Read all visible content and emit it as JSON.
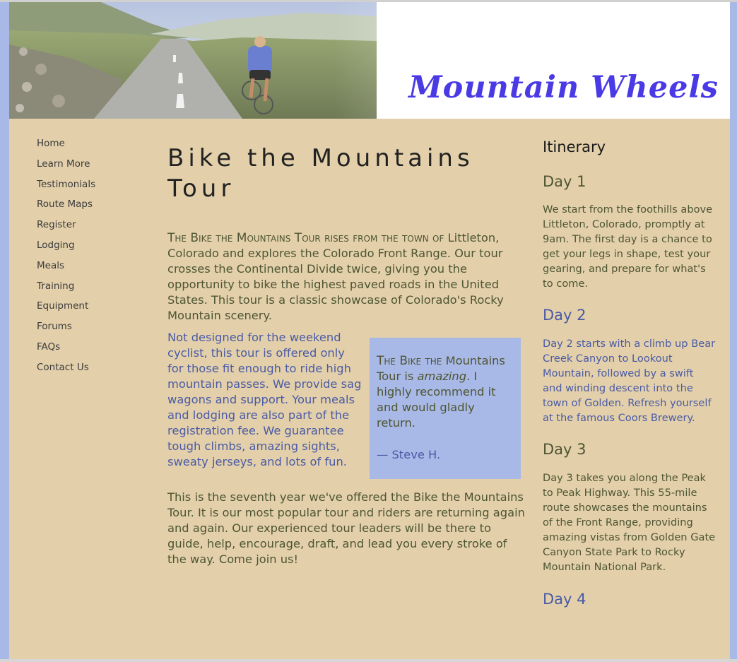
{
  "site": {
    "title": "Mountain Wheels"
  },
  "nav": {
    "items": [
      {
        "label": "Home"
      },
      {
        "label": "Learn More"
      },
      {
        "label": "Testimonials"
      },
      {
        "label": "Route Maps"
      },
      {
        "label": "Register"
      },
      {
        "label": "Lodging"
      },
      {
        "label": "Meals"
      },
      {
        "label": "Training"
      },
      {
        "label": "Equipment"
      },
      {
        "label": "Forums"
      },
      {
        "label": "FAQs"
      },
      {
        "label": "Contact Us"
      }
    ]
  },
  "main": {
    "title": "Bike the Mountains Tour",
    "intro_lead": "The Bike the Mountains Tour rises from the town of",
    "intro_rest": " Littleton, Colorado and explores the Colorado Front Range. Our tour crosses the Continental Divide twice, giving you the opportunity to bike the highest paved roads in the United States. This tour is a classic showcase of Colorado's Rocky Mountain scenery.",
    "fit_text": "Not designed for the weekend cyclist, this tour is offered only for those fit enough to ride high mountain passes. We provide sag wagons and support. Your meals and lodging are also part of the registration fee. We guarantee tough climbs, amazing sights, sweaty jerseys, and lots of fun.",
    "testimonial": {
      "lead": "The Bike the",
      "middle": " Mountains Tour is ",
      "emphasis": "amazing",
      "rest": ". I highly recommend it and would gladly return.",
      "author": "— Steve H."
    },
    "closing": "This is the seventh year we've offered the Bike the Mountains Tour. It is our most popular tour and riders are returning again and again. Our experienced tour leaders will be there to guide, help, encourage, draft, and lead you every stroke of the way. Come join us!"
  },
  "aside": {
    "heading": "Itinerary",
    "days": [
      {
        "title": "Day 1",
        "text": "We start from the foothills above Littleton, Colorado, promptly at 9am. The first day is a chance to get your legs in shape, test your gearing, and prepare for what's to come."
      },
      {
        "title": "Day 2",
        "text": "Day 2 starts with a climb up Bear Creek Canyon to Lookout Mountain, followed by a swift and winding descent into the town of Golden. Refresh yourself at the famous Coors Brewery."
      },
      {
        "title": "Day 3",
        "text": "Day 3 takes you along the Peak to Peak Highway. This 55-mile route showcases the mountains of the Front Range, providing amazing vistas from Golden Gate Canyon State Park to Rocky Mountain National Park."
      },
      {
        "title": "Day 4",
        "text": ""
      }
    ]
  },
  "colors": {
    "page_background": "#a9b9e7",
    "content_background": "#e3d0ab",
    "title_blue": "#4a3ae6",
    "text_olive": "#4e5532",
    "text_blue": "#4a5aa5"
  }
}
